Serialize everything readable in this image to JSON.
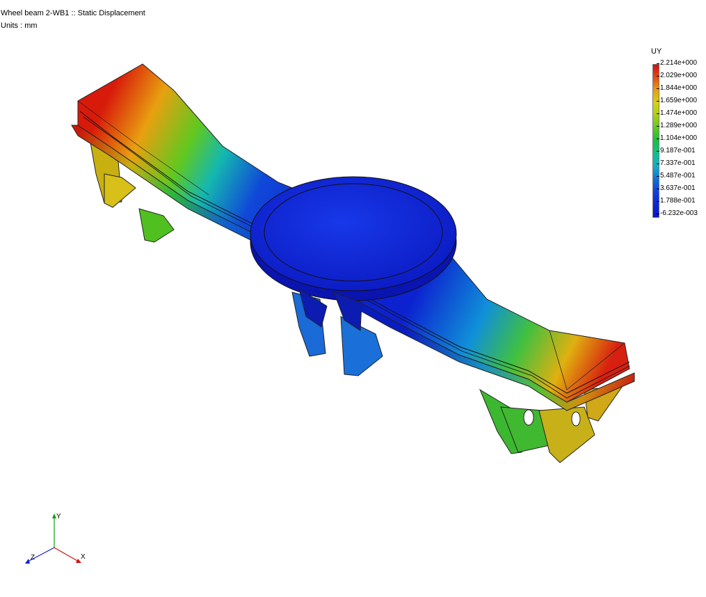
{
  "header": {
    "title": "Wheel beam 2-WB1 :: Static Displacement",
    "units": "Units : mm"
  },
  "legend": {
    "variable": "UY",
    "ticks": [
      "2.214e+000",
      "2.029e+000",
      "1.844e+000",
      "1.659e+000",
      "1.474e+000",
      "1.289e+000",
      "1.104e+000",
      "9.187e-001",
      "7.337e-001",
      "5.487e-001",
      "3.637e-001",
      "1.788e-001",
      "-6.232e-003"
    ],
    "colors": [
      "#d01010",
      "#e84a10",
      "#e6a010",
      "#d8d010",
      "#a8d010",
      "#5ec820",
      "#18c040",
      "#10c090",
      "#10b0c8",
      "#1070d8",
      "#1040e0",
      "#0a28d8",
      "#0a14c8"
    ]
  },
  "triad": {
    "x_label": "X",
    "y_label": "Y",
    "z_label": "Z",
    "x_color": "#d01010",
    "y_color": "#10a010",
    "z_color": "#1020d0"
  }
}
